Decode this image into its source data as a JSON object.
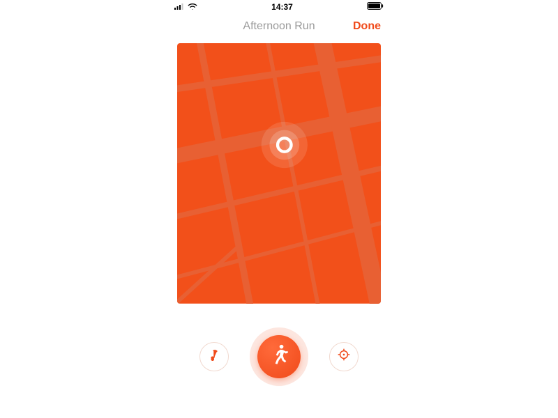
{
  "status": {
    "time": "14:37"
  },
  "nav": {
    "title": "Afternoon Run",
    "done_label": "Done"
  },
  "colors": {
    "accent": "#f04a1a",
    "map_base": "#f2501a",
    "map_road": "#ee6638"
  },
  "icons": {
    "music": "music-icon",
    "run": "run-icon",
    "locate": "locate-icon",
    "location_dot": "location-dot-icon"
  }
}
